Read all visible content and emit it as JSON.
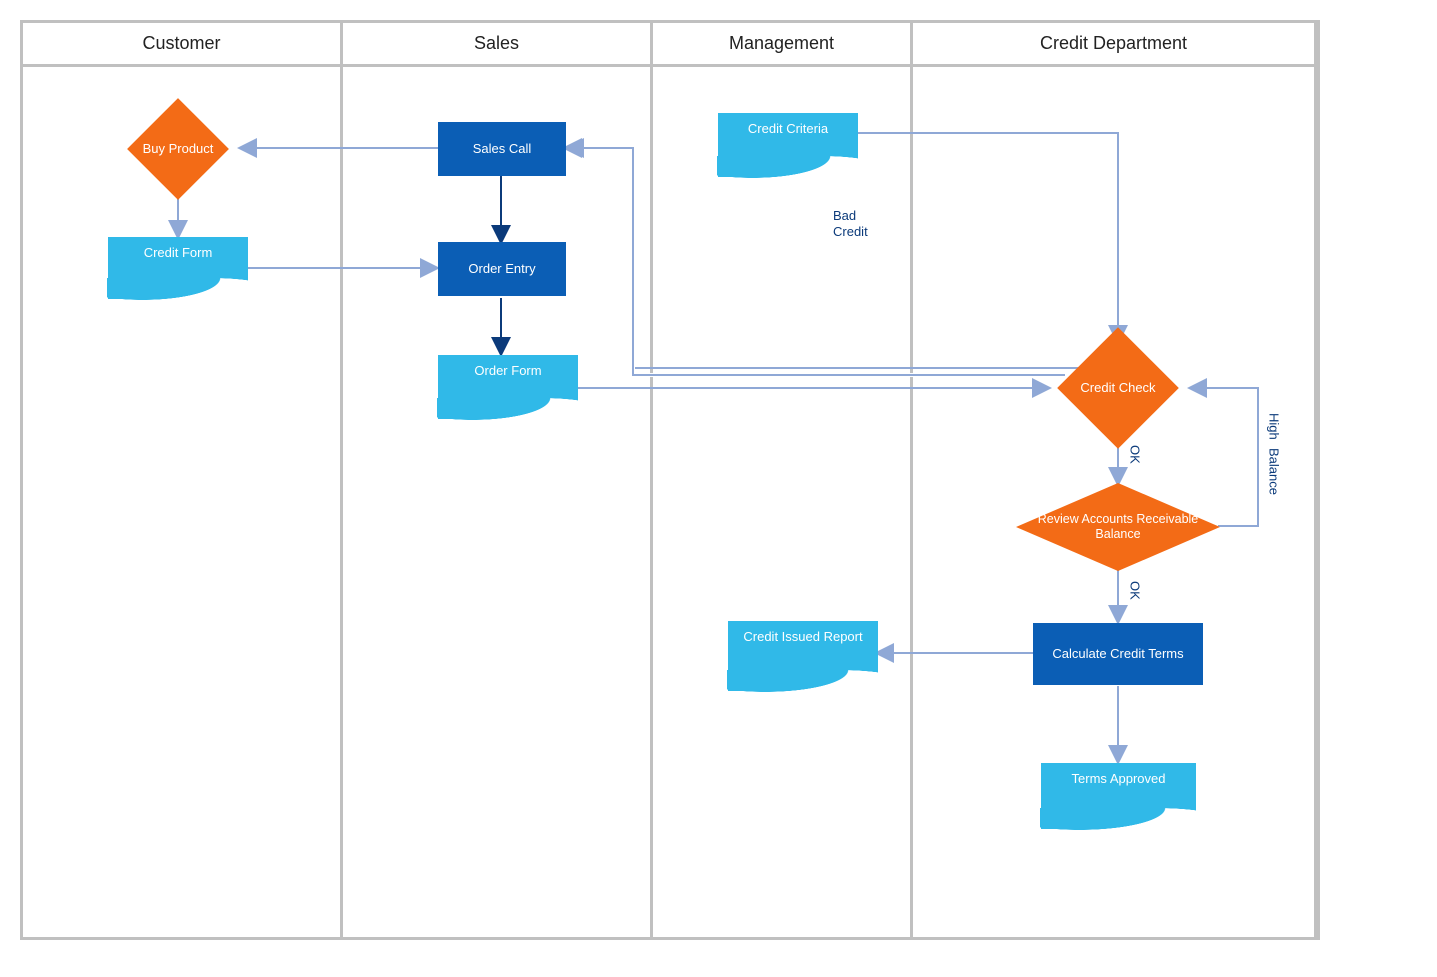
{
  "lanes": {
    "customer": "Customer",
    "sales": "Sales",
    "management": "Management",
    "credit_department": "Credit Department"
  },
  "nodes": {
    "buy_product": "Buy Product",
    "credit_form": "Credit Form",
    "sales_call": "Sales Call",
    "order_entry": "Order Entry",
    "order_form": "Order Form",
    "credit_criteria": "Credit Criteria",
    "credit_check": "Credit Check",
    "review_accounts": "Review Accounts Receivable Balance",
    "calculate_terms": "Calculate Credit Terms",
    "credit_issued_report": "Credit Issued Report",
    "terms_approved": "Terms Approved"
  },
  "edge_labels": {
    "bad_credit_line1": "Bad",
    "bad_credit_line2": "Credit",
    "ok1": "OK",
    "ok2": "OK",
    "high": "High",
    "balance": "Balance"
  },
  "colors": {
    "lane_border": "#c0c0c0",
    "process": "#0b5eb5",
    "decision": "#f36b16",
    "document": "#30b9e8",
    "arrow": "#8fa8d6",
    "arrow_dark": "#0b3a7a"
  }
}
